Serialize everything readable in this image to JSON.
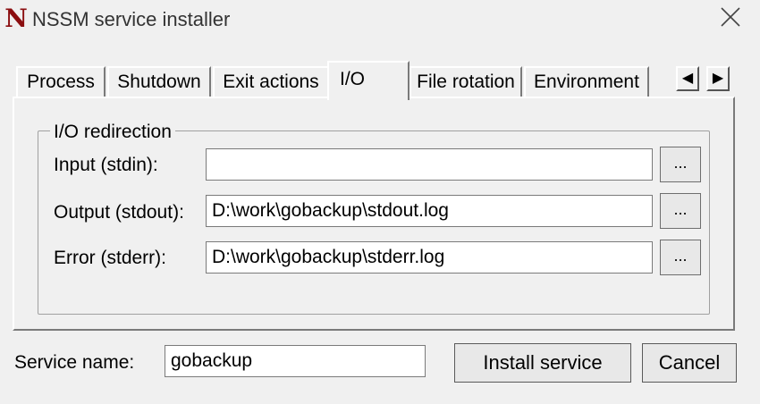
{
  "window": {
    "title": "NSSM service installer",
    "icon_glyph": "N",
    "icon_color": "#8b0e10"
  },
  "tabs": [
    {
      "label": "Process"
    },
    {
      "label": "Shutdown"
    },
    {
      "label": "Exit actions"
    },
    {
      "label": "I/O",
      "active": true
    },
    {
      "label": "File rotation"
    },
    {
      "label": "Environment"
    }
  ],
  "tab_scroll": {
    "left": "◀",
    "right": "▶"
  },
  "io": {
    "group_title": "I/O redirection",
    "input_label": "Input (stdin):",
    "input_value": "",
    "output_label": "Output (stdout):",
    "output_value": "D:\\work\\gobackup\\stdout.log",
    "error_label": "Error (stderr):",
    "error_value": "D:\\work\\gobackup\\stderr.log",
    "browse_label": "..."
  },
  "footer": {
    "service_name_label": "Service name:",
    "service_name_value": "gobackup",
    "install_label": "Install service",
    "cancel_label": "Cancel"
  }
}
